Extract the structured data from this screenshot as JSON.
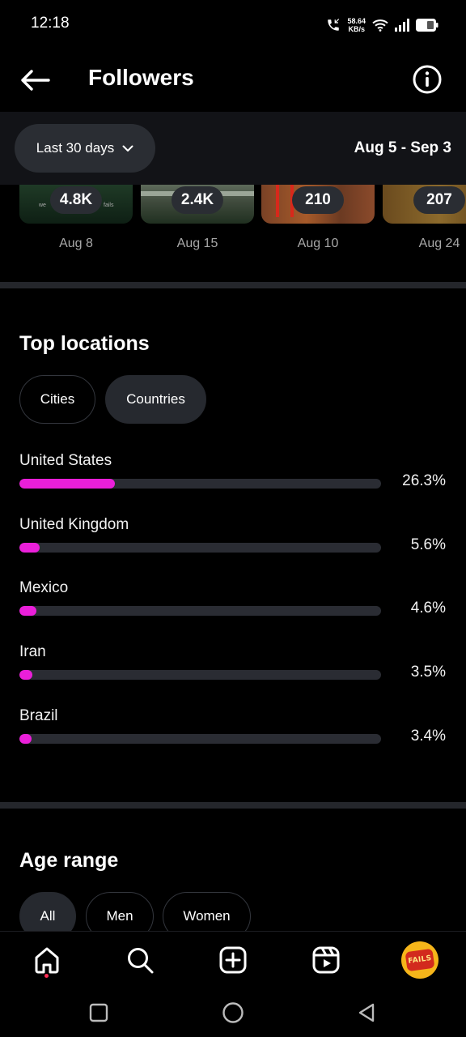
{
  "status_bar": {
    "time": "12:18",
    "net_speed_value": "58.64",
    "net_speed_unit": "KB/s",
    "icons": [
      "call-icon",
      "wifi-icon",
      "signal-icon",
      "battery-icon"
    ]
  },
  "header": {
    "title": "Followers",
    "back_icon": "arrow-left-icon",
    "info_icon": "info-icon"
  },
  "filter": {
    "range_label": "Last 30 days",
    "date_range": "Aug 5 - Sep 3"
  },
  "thumbnails": [
    {
      "count": "4.8K",
      "date": "Aug 8",
      "caption_left": "we",
      "caption_right": "fails"
    },
    {
      "count": "2.4K",
      "date": "Aug 15"
    },
    {
      "count": "210",
      "date": "Aug 10"
    },
    {
      "count": "207",
      "date": "Aug 24"
    }
  ],
  "top_locations": {
    "title": "Top locations",
    "tabs": [
      "Cities",
      "Countries"
    ],
    "active_tab": "Countries",
    "items": [
      {
        "name": "United States",
        "percent_label": "26.3%",
        "percent": 26.3
      },
      {
        "name": "United Kingdom",
        "percent_label": "5.6%",
        "percent": 5.6
      },
      {
        "name": "Mexico",
        "percent_label": "4.6%",
        "percent": 4.6
      },
      {
        "name": "Iran",
        "percent_label": "3.5%",
        "percent": 3.5
      },
      {
        "name": "Brazil",
        "percent_label": "3.4%",
        "percent": 3.4
      }
    ],
    "bar_color": "#ea1fd9"
  },
  "age_range": {
    "title": "Age range",
    "tabs": [
      "All",
      "Men",
      "Women"
    ],
    "active_tab": "All"
  },
  "bottom_nav": {
    "items": [
      "home-icon",
      "search-icon",
      "create-icon",
      "reels-icon"
    ],
    "avatar_text": "FAILS"
  },
  "system_nav": [
    "recents-icon",
    "home-circle-icon",
    "back-triangle-icon"
  ]
}
